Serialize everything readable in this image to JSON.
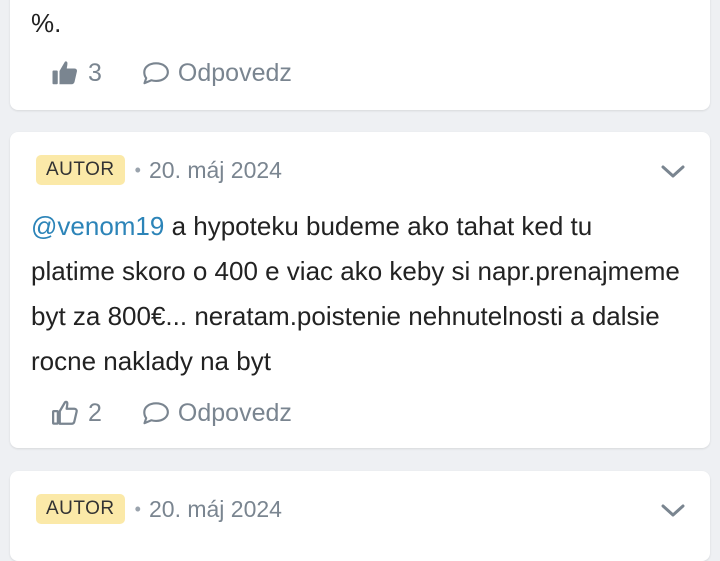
{
  "comments": [
    {
      "text_tail": "%.",
      "likes": "3",
      "reply_label": "Odpovedz"
    },
    {
      "badge": "AUTOR",
      "date": "20. máj 2024",
      "mention": "@venom19",
      "text": " a hypoteku budeme ako tahat ked tu platime skoro o 400 e viac ako keby si napr.prenajmeme byt za 800€... neratam.poistenie nehnutelnosti a dalsie rocne naklady na byt",
      "likes": "2",
      "reply_label": "Odpovedz"
    },
    {
      "badge": "AUTOR",
      "date": "20. máj 2024"
    }
  ],
  "icons": {
    "like_filled": "thumbs-up-filled-icon",
    "like_outline": "thumbs-up-outline-icon",
    "reply": "speech-bubble-icon",
    "expand": "chevron-down-icon"
  },
  "colors": {
    "badge_bg": "#fbe9a8",
    "mention": "#2c84b8",
    "muted": "#7a8590",
    "background": "#eef0f3"
  }
}
